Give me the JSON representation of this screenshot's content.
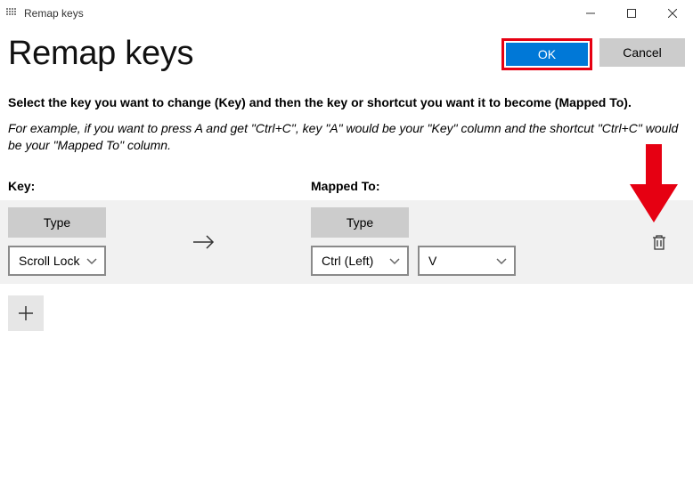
{
  "window": {
    "title": "Remap keys"
  },
  "header": {
    "page_title": "Remap keys",
    "ok_label": "OK",
    "cancel_label": "Cancel"
  },
  "instructions": {
    "main": "Select the key you want to change (Key) and then the key or shortcut you want it to become (Mapped To).",
    "example": "For example, if you want to press A and get \"Ctrl+C\", key \"A\" would be your \"Key\" column and the shortcut \"Ctrl+C\" would be your \"Mapped To\" column."
  },
  "columns": {
    "key_header": "Key:",
    "mapped_header": "Mapped To:"
  },
  "row": {
    "type_label": "Type",
    "key_selected": "Scroll Lock",
    "mapped_modifier": "Ctrl (Left)",
    "mapped_key": "V"
  },
  "colors": {
    "accent": "#0078d7",
    "highlight_border": "#e60012",
    "annotation_arrow": "#e60012"
  }
}
